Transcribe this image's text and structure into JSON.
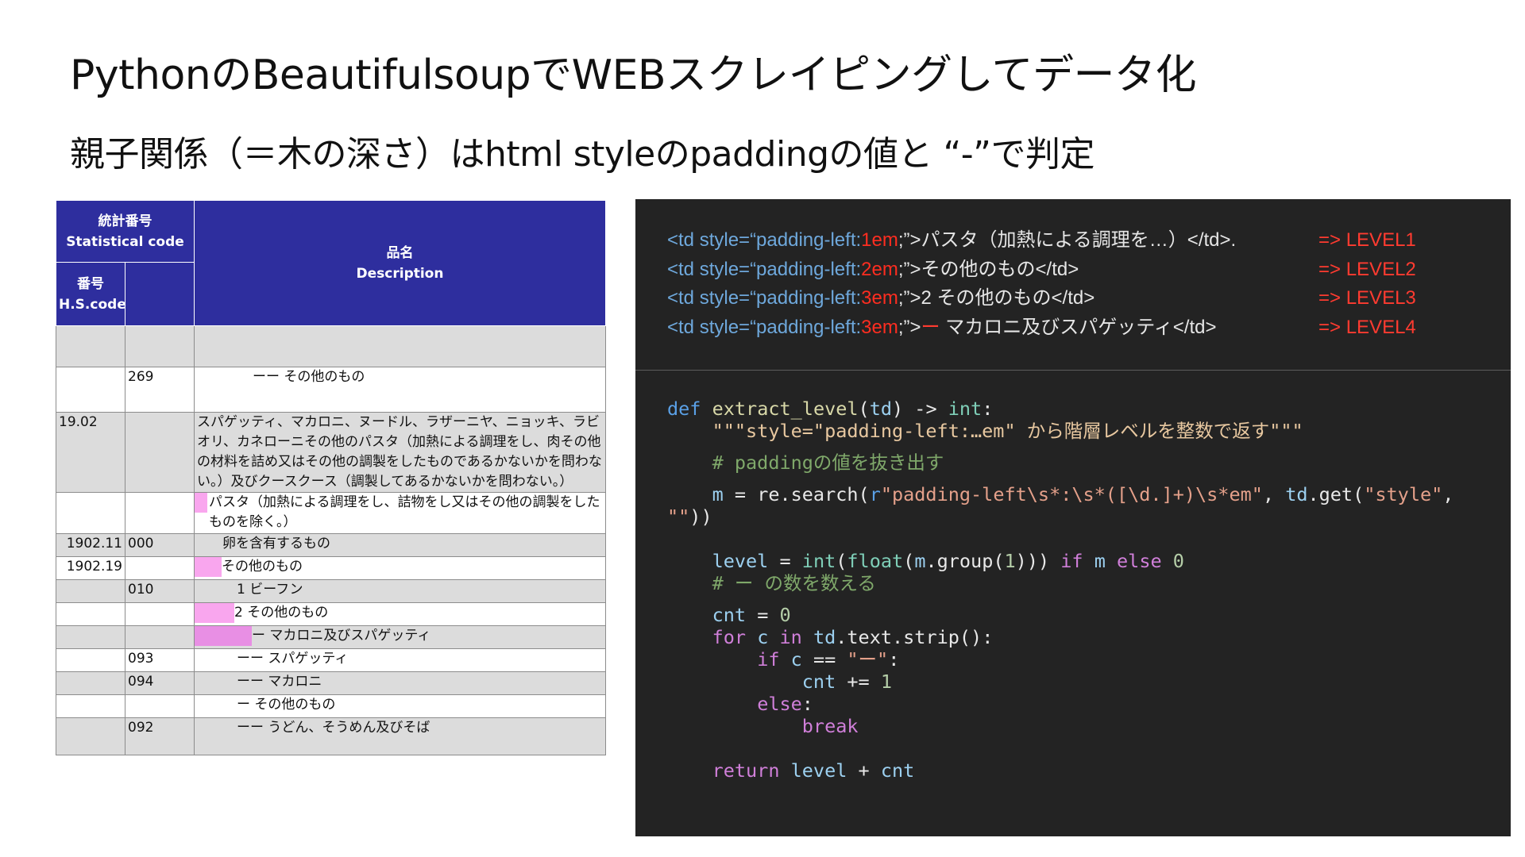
{
  "slide": {
    "title": "PythonのBeautifulsoupでWEBスクレイピングしてデータ化",
    "subtitle": "親子関係（＝木の深さ）はhtml styleのpaddingの値と “-”で判定"
  },
  "table": {
    "header": {
      "stat_code_ja": "統計番号",
      "stat_code_en": "Statistical code",
      "hs_ja": "番号",
      "hs_en": "H.S.code",
      "desc_ja": "品名",
      "desc_en": "Description"
    },
    "rows": [
      {
        "c1": "",
        "c2": "",
        "desc": ""
      },
      {
        "c1": "",
        "c2": "269",
        "desc": "ーー その他のもの"
      },
      {
        "c1": "19.02",
        "c2": "",
        "desc": "スパゲッティ、マカロニ、ヌードル、ラザーニヤ、ニョッキ、ラビオリ、カネローニその他のパスタ（加熱による調理をし、肉その他の材料を詰め又はその他の調製をしたものであるかないかを問わない。）及びクースクース（調製してあるかないかを問わない。）"
      },
      {
        "c1": "",
        "c2": "",
        "desc": "パスタ（加熱による調理をし、詰物をし又はその他の調製をしたものを除く。）"
      },
      {
        "c1": "1902.11",
        "c2": "000",
        "desc": "卵を含有するもの"
      },
      {
        "c1": "1902.19",
        "c2": "",
        "desc": "その他のもの"
      },
      {
        "c1": "",
        "c2": "010",
        "desc": "1 ビーフン"
      },
      {
        "c1": "",
        "c2": "",
        "desc": "2 その他のもの"
      },
      {
        "c1": "",
        "c2": "",
        "desc": "ー マカロニ及びスパゲッティ"
      },
      {
        "c1": "",
        "c2": "093",
        "desc": "ーー スパゲッティ"
      },
      {
        "c1": "",
        "c2": "094",
        "desc": "ーー マカロニ"
      },
      {
        "c1": "",
        "c2": "",
        "desc": "ー その他のもの"
      },
      {
        "c1": "",
        "c2": "092",
        "desc": "ーー うどん、そうめん及びそば"
      }
    ]
  },
  "html_examples": [
    {
      "open": "<td style=“padding-left:",
      "value": "1em",
      "close": ";”>",
      "content": "パスタ（加熱による調理を…）</td>.",
      "dash": "",
      "level": "=> LEVEL1"
    },
    {
      "open": "<td style=“padding-left:",
      "value": "2em",
      "close": ";”>",
      "content": "その他のもの</td>",
      "dash": "",
      "level": "=> LEVEL2"
    },
    {
      "open": "<td style=“padding-left:",
      "value": "3em",
      "close": ";”>",
      "content": "2 その他のもの</td>",
      "dash": "",
      "level": "=> LEVEL3"
    },
    {
      "open": "<td style=“padding-left:",
      "value": "3em",
      "close": ";”>",
      "content": " マカロニ及びスパゲッティ</td>",
      "dash": "ー",
      "level": "=> LEVEL4"
    }
  ],
  "code": {
    "def": "def",
    "fn_name": "extract_level",
    "param": "td",
    "arrow": "->",
    "ret_type": "int",
    "docstring": "\"\"\"style=\"padding-left:…em\" から階層レベルを整数で返す\"\"\"",
    "comment1": "# paddingの値を抜き出す",
    "re_pattern": "\"padding-left\\s*:\\s*([\\d.]+)\\s*em\"",
    "get_arg": "\"style\"",
    "empty_str": "\"\"",
    "comment2": "# ー の数を数える",
    "dash_literal": "\"ー\""
  }
}
